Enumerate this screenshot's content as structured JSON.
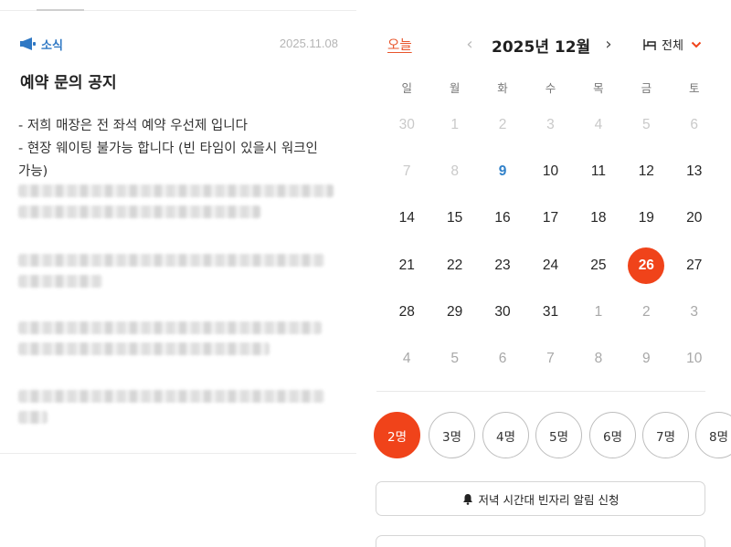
{
  "news": {
    "tag": "소식",
    "date": "2025.11.08",
    "title": "예약 문의 공지",
    "lines": [
      "- 저희 매장은 전 좌석 예약 우선제 입니다",
      "- 현장 웨이팅 불가능 합니다 (빈 타임이 있을시 워크인",
      "가능)"
    ]
  },
  "calendar": {
    "today_label": "오늘",
    "month_title": "2025년  12월",
    "prev_glyph": "‹",
    "next_glyph": "›",
    "filter_label": "전체",
    "weekdays": [
      "일",
      "월",
      "화",
      "수",
      "목",
      "금",
      "토"
    ],
    "weeks": [
      [
        {
          "d": "30",
          "s": "muted"
        },
        {
          "d": "1",
          "s": "muted"
        },
        {
          "d": "2",
          "s": "muted"
        },
        {
          "d": "3",
          "s": "muted"
        },
        {
          "d": "4",
          "s": "muted"
        },
        {
          "d": "5",
          "s": "muted"
        },
        {
          "d": "6",
          "s": "muted"
        }
      ],
      [
        {
          "d": "7",
          "s": "muted"
        },
        {
          "d": "8",
          "s": "muted"
        },
        {
          "d": "9",
          "s": "today"
        },
        {
          "d": "10",
          "s": ""
        },
        {
          "d": "11",
          "s": ""
        },
        {
          "d": "12",
          "s": ""
        },
        {
          "d": "13",
          "s": ""
        }
      ],
      [
        {
          "d": "14",
          "s": ""
        },
        {
          "d": "15",
          "s": ""
        },
        {
          "d": "16",
          "s": ""
        },
        {
          "d": "17",
          "s": ""
        },
        {
          "d": "18",
          "s": ""
        },
        {
          "d": "19",
          "s": ""
        },
        {
          "d": "20",
          "s": ""
        }
      ],
      [
        {
          "d": "21",
          "s": ""
        },
        {
          "d": "22",
          "s": ""
        },
        {
          "d": "23",
          "s": ""
        },
        {
          "d": "24",
          "s": ""
        },
        {
          "d": "25",
          "s": ""
        },
        {
          "d": "26",
          "s": "selected"
        },
        {
          "d": "27",
          "s": ""
        }
      ],
      [
        {
          "d": "28",
          "s": ""
        },
        {
          "d": "29",
          "s": ""
        },
        {
          "d": "30",
          "s": ""
        },
        {
          "d": "31",
          "s": ""
        },
        {
          "d": "1",
          "s": "dim"
        },
        {
          "d": "2",
          "s": "dim"
        },
        {
          "d": "3",
          "s": "dim"
        }
      ],
      [
        {
          "d": "4",
          "s": "dim"
        },
        {
          "d": "5",
          "s": "dim"
        },
        {
          "d": "6",
          "s": "dim"
        },
        {
          "d": "7",
          "s": "dim"
        },
        {
          "d": "8",
          "s": "dim"
        },
        {
          "d": "9",
          "s": "dim"
        },
        {
          "d": "10",
          "s": "dim"
        }
      ]
    ]
  },
  "party": {
    "options": [
      "2명",
      "3명",
      "4명",
      "5명",
      "6명",
      "7명",
      "8명"
    ],
    "selected": "2명"
  },
  "alert_button_label": "저녁 시간대 빈자리 알림 신청",
  "colors": {
    "accent": "#f0431a",
    "today_link": "#e8552b",
    "news_tag": "#2f78c4",
    "today_date": "#2f80c9"
  }
}
